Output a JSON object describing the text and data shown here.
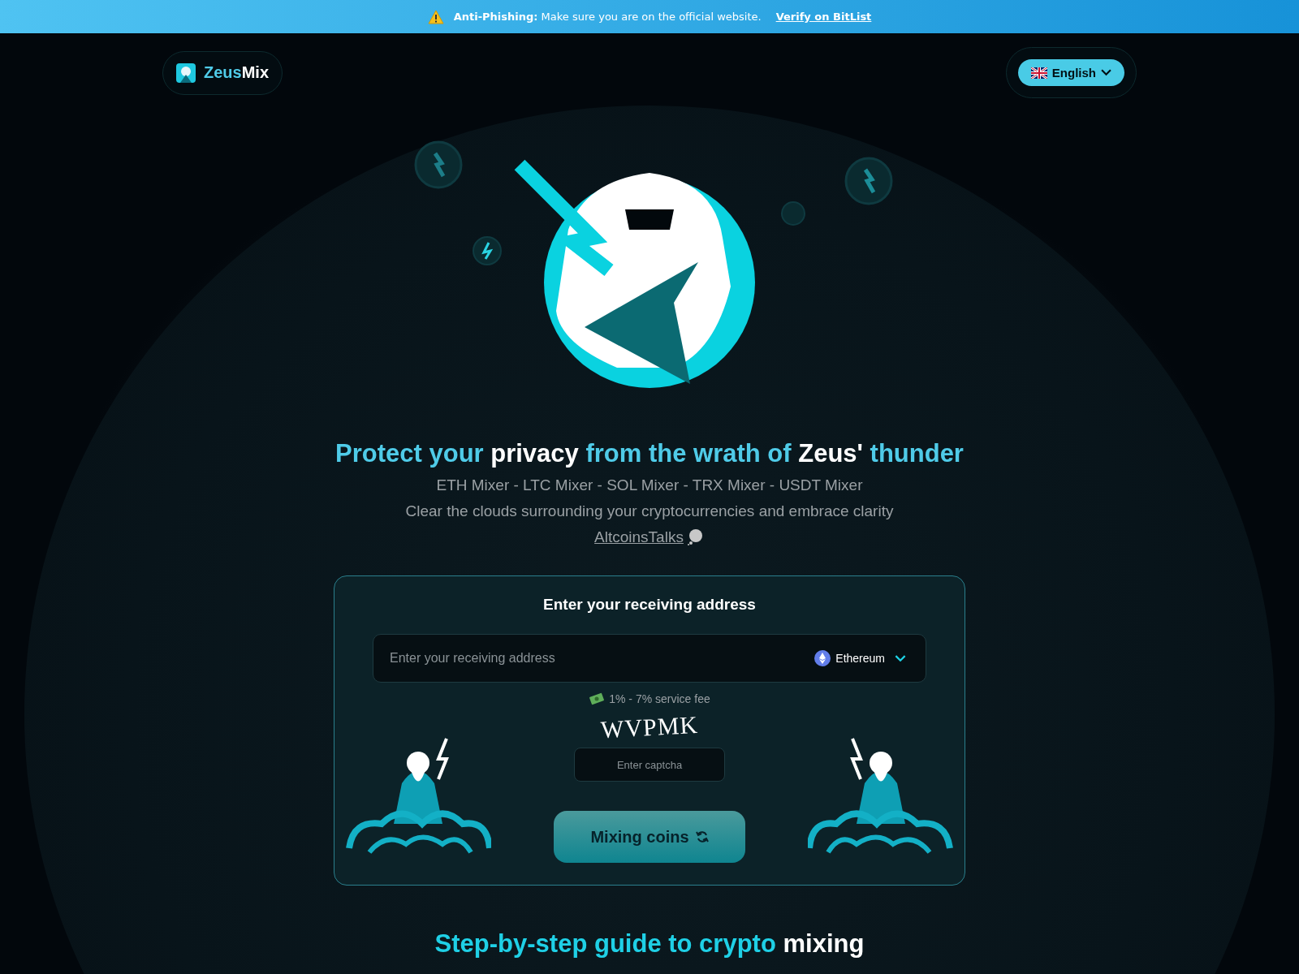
{
  "banner": {
    "label": "Anti-Phishing:",
    "message": "Make sure you are on the official website.",
    "link": "Verify on BitList"
  },
  "header": {
    "logo_parts": [
      {
        "text": "Zeus",
        "highlight": true
      },
      {
        "text": "Mix",
        "highlight": false
      }
    ],
    "language": "English"
  },
  "hero": {
    "headline": [
      {
        "text": "Protect your ",
        "highlight": true
      },
      {
        "text": "privacy",
        "highlight": false
      },
      {
        "text": " from the wrath of ",
        "highlight": true
      },
      {
        "text": "Zeus'",
        "highlight": false
      },
      {
        "text": " thunder",
        "highlight": true
      }
    ],
    "subtitle": "ETH Mixer - LTC Mixer - SOL Mixer - TRX Mixer - USDT Mixer",
    "tagline": "Clear the clouds surrounding your cryptocurrencies and embrace clarity",
    "link": "AltcoinsTalks"
  },
  "form": {
    "title": "Enter your receiving address",
    "address_placeholder": "Enter your receiving address",
    "currency": "Ethereum",
    "fee": "1% - 7% service fee",
    "captcha_code": "WVPMK",
    "captcha_placeholder": "Enter captcha",
    "submit": "Mixing coins"
  },
  "guide": {
    "heading": [
      {
        "text": "Step-by-step guide to crypto ",
        "highlight": true
      },
      {
        "text": "mixing",
        "highlight": false
      }
    ]
  }
}
